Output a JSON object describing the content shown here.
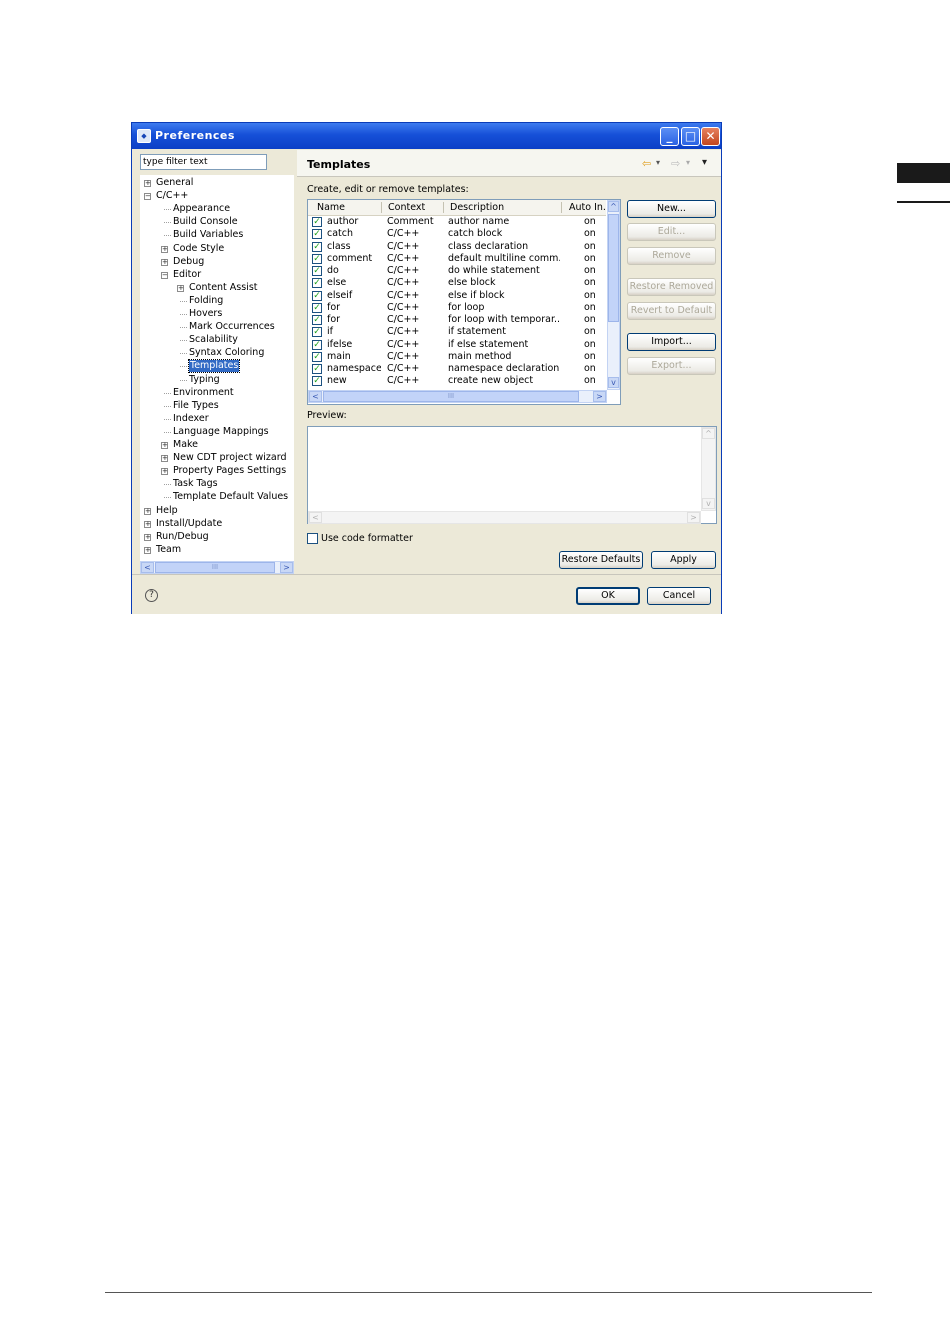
{
  "window": {
    "title": "Preferences",
    "minimize_glyph": "_",
    "maximize_glyph": "□",
    "close_glyph": "✕"
  },
  "filter": {
    "value": "type filter text"
  },
  "tree": {
    "items": [
      {
        "label": "General",
        "level": 0,
        "expander": "+"
      },
      {
        "label": "C/C++",
        "level": 0,
        "expander": "−"
      },
      {
        "label": "Appearance",
        "level": 1,
        "expander": ""
      },
      {
        "label": "Build Console",
        "level": 1,
        "expander": ""
      },
      {
        "label": "Build Variables",
        "level": 1,
        "expander": ""
      },
      {
        "label": "Code Style",
        "level": 1,
        "expander": "+"
      },
      {
        "label": "Debug",
        "level": 1,
        "expander": "+"
      },
      {
        "label": "Editor",
        "level": 1,
        "expander": "−"
      },
      {
        "label": "Content Assist",
        "level": 2,
        "expander": "+"
      },
      {
        "label": "Folding",
        "level": 2,
        "expander": ""
      },
      {
        "label": "Hovers",
        "level": 2,
        "expander": ""
      },
      {
        "label": "Mark Occurrences",
        "level": 2,
        "expander": ""
      },
      {
        "label": "Scalability",
        "level": 2,
        "expander": ""
      },
      {
        "label": "Syntax Coloring",
        "level": 2,
        "expander": ""
      },
      {
        "label": "Templates",
        "level": 2,
        "expander": "",
        "selected": true
      },
      {
        "label": "Typing",
        "level": 2,
        "expander": ""
      },
      {
        "label": "Environment",
        "level": 1,
        "expander": ""
      },
      {
        "label": "File Types",
        "level": 1,
        "expander": ""
      },
      {
        "label": "Indexer",
        "level": 1,
        "expander": ""
      },
      {
        "label": "Language Mappings",
        "level": 1,
        "expander": ""
      },
      {
        "label": "Make",
        "level": 1,
        "expander": "+"
      },
      {
        "label": "New CDT project wizard",
        "level": 1,
        "expander": "+"
      },
      {
        "label": "Property Pages Settings",
        "level": 1,
        "expander": "+"
      },
      {
        "label": "Task Tags",
        "level": 1,
        "expander": ""
      },
      {
        "label": "Template Default Values",
        "level": 1,
        "expander": ""
      },
      {
        "label": "Help",
        "level": 0,
        "expander": "+"
      },
      {
        "label": "Install/Update",
        "level": 0,
        "expander": "+"
      },
      {
        "label": "Run/Debug",
        "level": 0,
        "expander": "+"
      },
      {
        "label": "Team",
        "level": 0,
        "expander": "+"
      }
    ]
  },
  "templates": {
    "title": "Templates",
    "nav_back": "⇦",
    "nav_forward": "⇨",
    "nav_menu": "▾",
    "caption": "Create, edit or remove templates:",
    "columns": [
      "Name",
      "Context",
      "Description",
      "Auto In..."
    ],
    "rows": [
      {
        "name": "author",
        "context": "Comment",
        "description": "author name",
        "auto": "on"
      },
      {
        "name": "catch",
        "context": "C/C++",
        "description": "catch block",
        "auto": "on"
      },
      {
        "name": "class",
        "context": "C/C++",
        "description": "class declaration",
        "auto": "on"
      },
      {
        "name": "comment",
        "context": "C/C++",
        "description": "default multiline comm...",
        "auto": "on"
      },
      {
        "name": "do",
        "context": "C/C++",
        "description": "do while statement",
        "auto": "on"
      },
      {
        "name": "else",
        "context": "C/C++",
        "description": "else block",
        "auto": "on"
      },
      {
        "name": "elseif",
        "context": "C/C++",
        "description": "else if block",
        "auto": "on"
      },
      {
        "name": "for",
        "context": "C/C++",
        "description": "for loop",
        "auto": "on"
      },
      {
        "name": "for",
        "context": "C/C++",
        "description": "for loop with temporar...",
        "auto": "on"
      },
      {
        "name": "if",
        "context": "C/C++",
        "description": "if statement",
        "auto": "on"
      },
      {
        "name": "ifelse",
        "context": "C/C++",
        "description": "if else statement",
        "auto": "on"
      },
      {
        "name": "main",
        "context": "C/C++",
        "description": "main method",
        "auto": "on"
      },
      {
        "name": "namespace",
        "context": "C/C++",
        "description": "namespace declaration",
        "auto": "on"
      },
      {
        "name": "new",
        "context": "C/C++",
        "description": "create new object",
        "auto": "on"
      }
    ],
    "buttons": {
      "new": "New...",
      "edit": "Edit...",
      "remove": "Remove",
      "restore_removed": "Restore Removed",
      "revert_default": "Revert to Default",
      "import": "Import...",
      "export": "Export..."
    },
    "preview_label": "Preview:",
    "use_formatter_label": "Use code formatter",
    "restore_defaults": "Restore Defaults",
    "apply": "Apply"
  },
  "footer": {
    "ok": "OK",
    "cancel": "Cancel",
    "help_glyph": "?"
  },
  "scroll_glyphs": {
    "left": "<",
    "right": ">",
    "up": "^",
    "down": "v",
    "grip": "III"
  }
}
